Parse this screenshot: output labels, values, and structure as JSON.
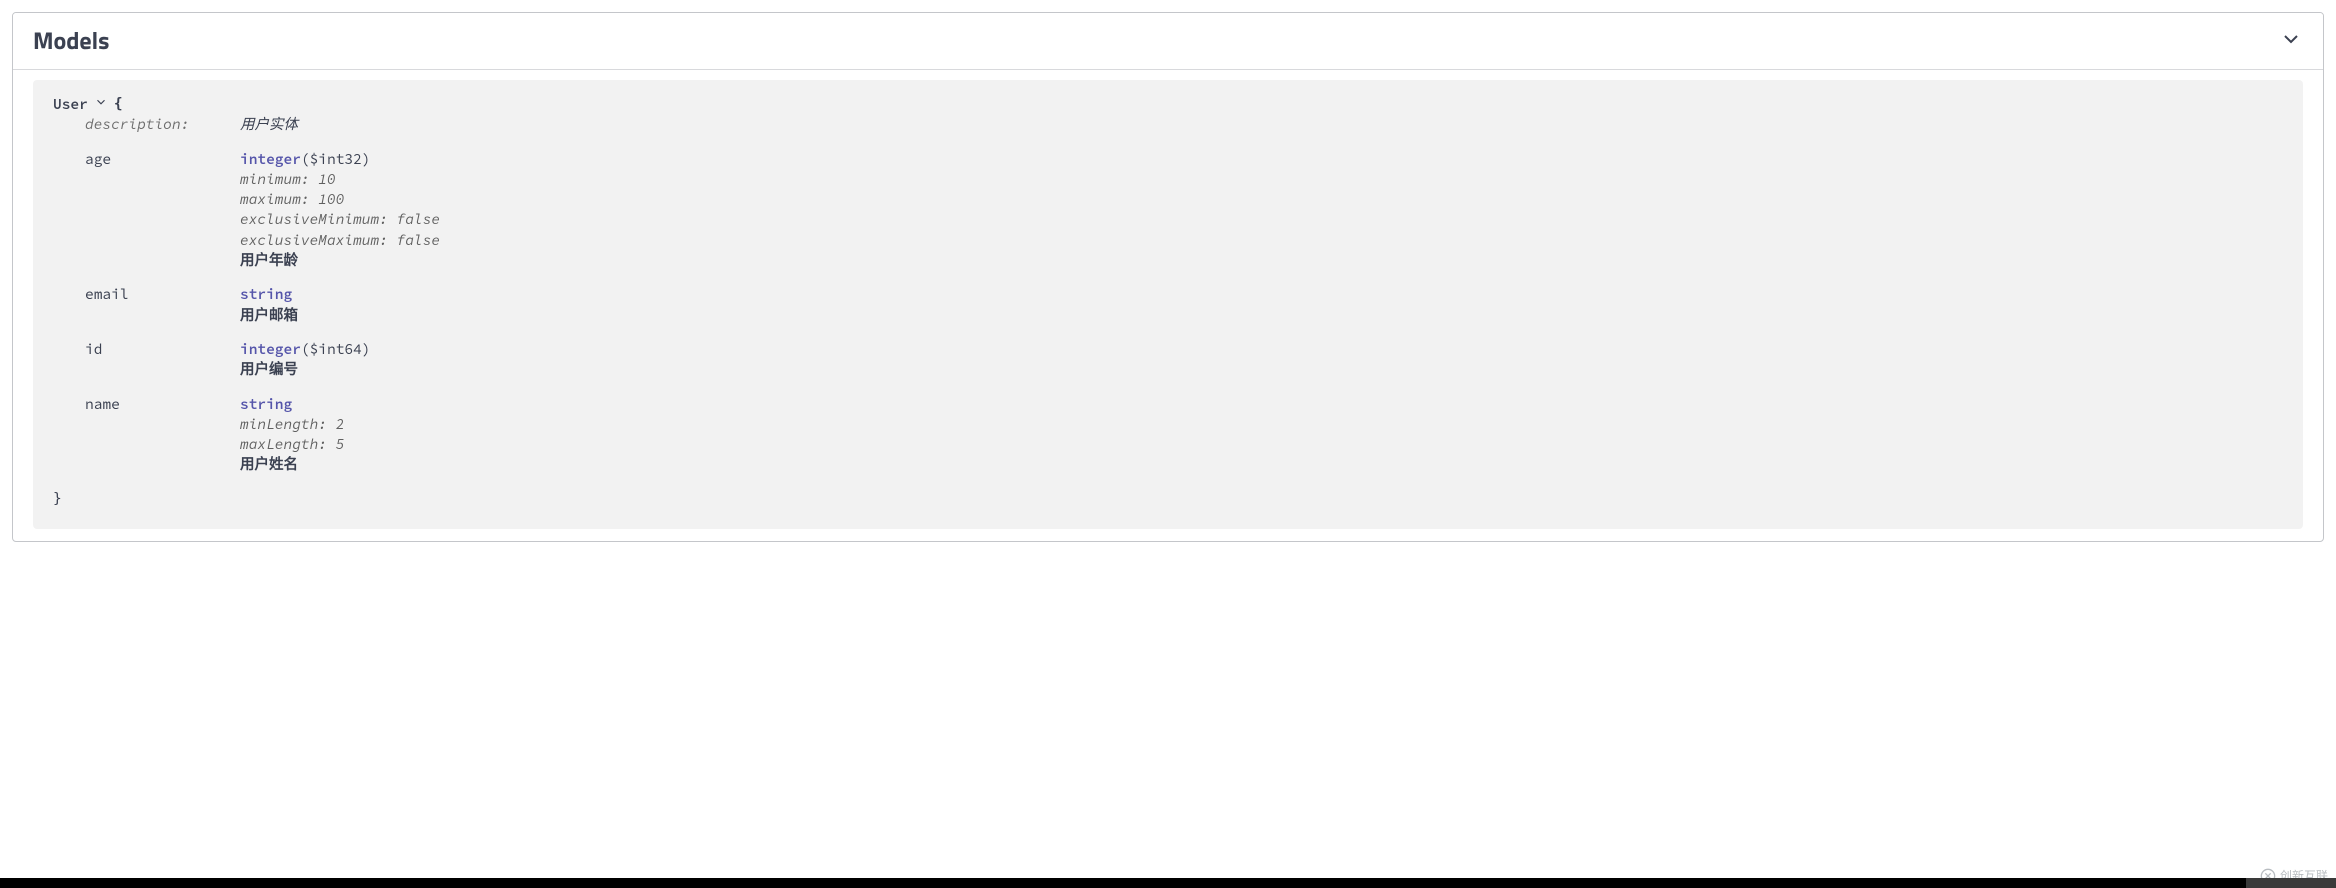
{
  "section": {
    "title": "Models"
  },
  "model": {
    "name": "User",
    "open_brace": "{",
    "close_brace": "}",
    "description_label": "description:",
    "description_value": "用户实体",
    "props": {
      "age": {
        "key": "age",
        "type": "integer",
        "format": "($int32)",
        "minimum": "minimum: 10",
        "maximum": "maximum: 100",
        "excl_min": "exclusiveMinimum: false",
        "excl_max": "exclusiveMaximum: false",
        "desc": "用户年龄"
      },
      "email": {
        "key": "email",
        "type": "string",
        "desc": "用户邮箱"
      },
      "id": {
        "key": "id",
        "type": "integer",
        "format": "($int64)",
        "desc": "用户编号"
      },
      "name": {
        "key": "name",
        "type": "string",
        "min_len": "minLength: 2",
        "max_len": "maxLength: 5",
        "desc": "用户姓名"
      }
    }
  },
  "watermark": {
    "text": "创新互联"
  }
}
